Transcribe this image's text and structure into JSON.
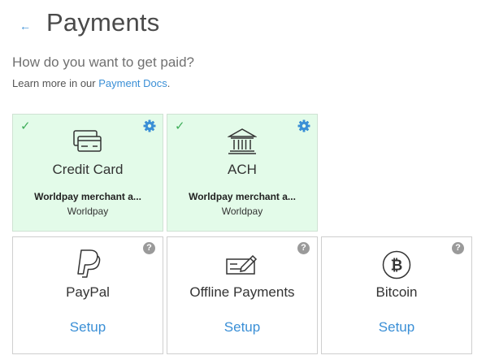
{
  "header": {
    "back_icon": "left-arrow-icon",
    "title": "Payments"
  },
  "intro": {
    "question": "How do you want to get paid?",
    "learn_more_prefix": "Learn more in our ",
    "learn_more_link": "Payment Docs",
    "learn_more_suffix": "."
  },
  "colors": {
    "accent": "#3a8fd6",
    "active_bg": "#e3fbe9",
    "check": "#3fae5a",
    "help_badge": "#9a9a9a"
  },
  "methods": [
    {
      "name": "Credit Card",
      "icon": "credit-card-icon",
      "status": "active",
      "merchant": "Worldpay merchant a...",
      "provider": "Worldpay"
    },
    {
      "name": "ACH",
      "icon": "bank-icon",
      "status": "active",
      "merchant": "Worldpay merchant a...",
      "provider": "Worldpay"
    },
    {
      "name": "PayPal",
      "icon": "paypal-icon",
      "status": "inactive",
      "action": "Setup"
    },
    {
      "name": "Offline Payments",
      "icon": "check-payment-icon",
      "status": "inactive",
      "action": "Setup"
    },
    {
      "name": "Bitcoin",
      "icon": "bitcoin-icon",
      "status": "inactive",
      "action": "Setup"
    }
  ]
}
